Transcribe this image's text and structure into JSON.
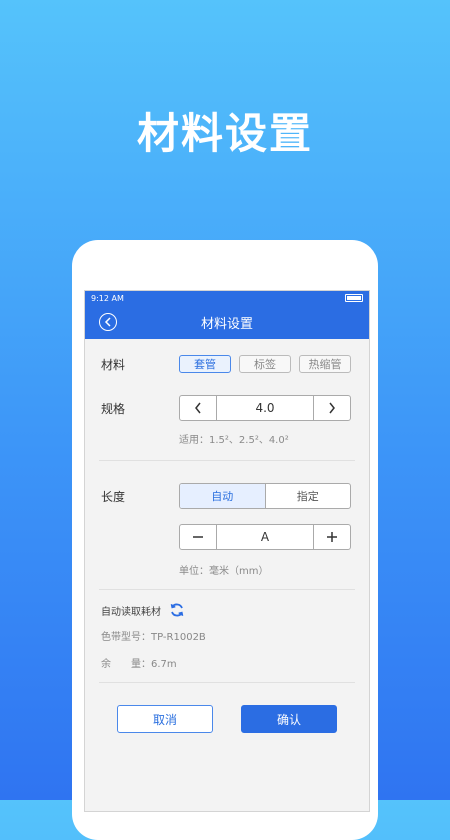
{
  "promo": {
    "title": "材料设置"
  },
  "status": {
    "time": "9:12 AM"
  },
  "nav": {
    "title": "材料设置"
  },
  "material": {
    "label": "材料",
    "options": [
      "套管",
      "标签",
      "热缩管"
    ],
    "selected": "套管"
  },
  "spec": {
    "label": "规格",
    "value": "4.0",
    "hint": "适用：1.5²、2.5²、4.0²"
  },
  "length": {
    "label": "长度",
    "modes": [
      "自动",
      "指定"
    ],
    "selected_mode": "自动",
    "value": "A",
    "unit_hint": "单位：毫米（mm）"
  },
  "auto_read": {
    "label": "自动读取耗材",
    "ribbon_model_label": "色带型号：",
    "ribbon_model_value": "TP-R1002B",
    "remaining_label": "余　　量：",
    "remaining_value": "6.7m"
  },
  "actions": {
    "cancel": "取消",
    "confirm": "确认"
  },
  "colors": {
    "primary": "#2b6de3",
    "accent": "#4a88ea"
  }
}
